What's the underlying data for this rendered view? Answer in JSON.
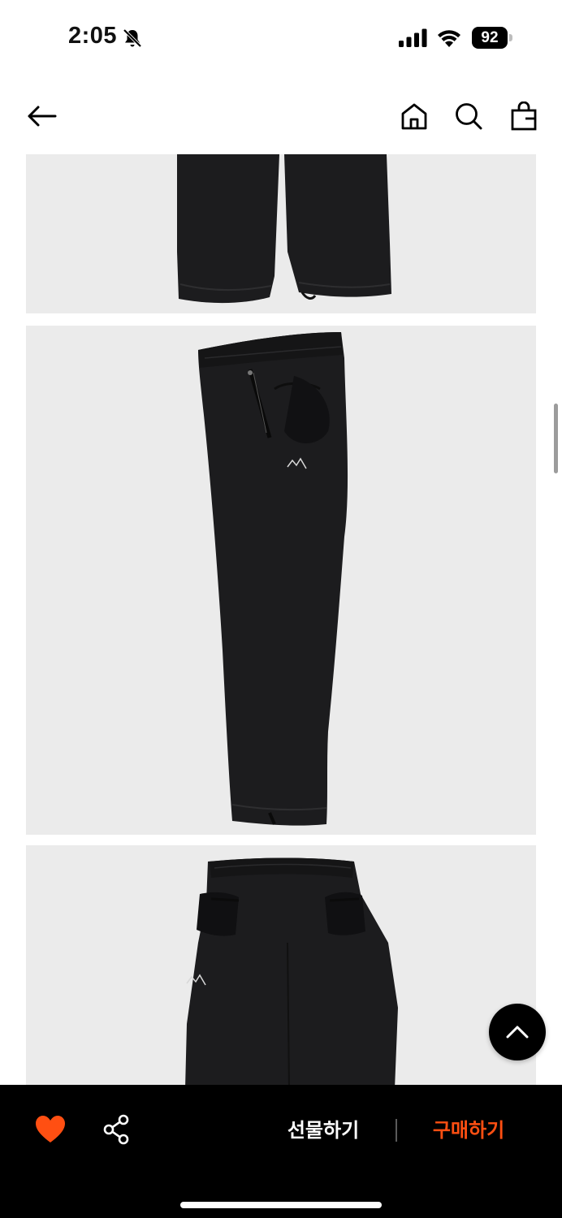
{
  "status_bar": {
    "time": "2:05",
    "battery": "92",
    "icons": [
      "bell-slash-icon",
      "cellular-signal-icon",
      "wifi-icon",
      "battery-icon"
    ]
  },
  "header": {
    "back_icon": "arrow-left-icon",
    "actions": [
      "home-icon",
      "search-icon",
      "shopping-bag-icon"
    ]
  },
  "product_images": [
    {
      "view": "pants-lower-legs",
      "background": "#ebebeb"
    },
    {
      "view": "pants-side-view",
      "background": "#ebebeb"
    },
    {
      "view": "pants-back-view",
      "background": "#ebebeb"
    }
  ],
  "scroll_top_icon": "chevron-up-icon",
  "bottom_bar": {
    "like_icon": "heart-icon",
    "share_icon": "share-icon",
    "gift_label": "선물하기",
    "buy_label": "구매하기"
  },
  "colors": {
    "accent": "#ff4f12",
    "bottom_bar_bg": "#000000",
    "image_bg": "#ebebeb",
    "garment": "#1c1c1e"
  }
}
